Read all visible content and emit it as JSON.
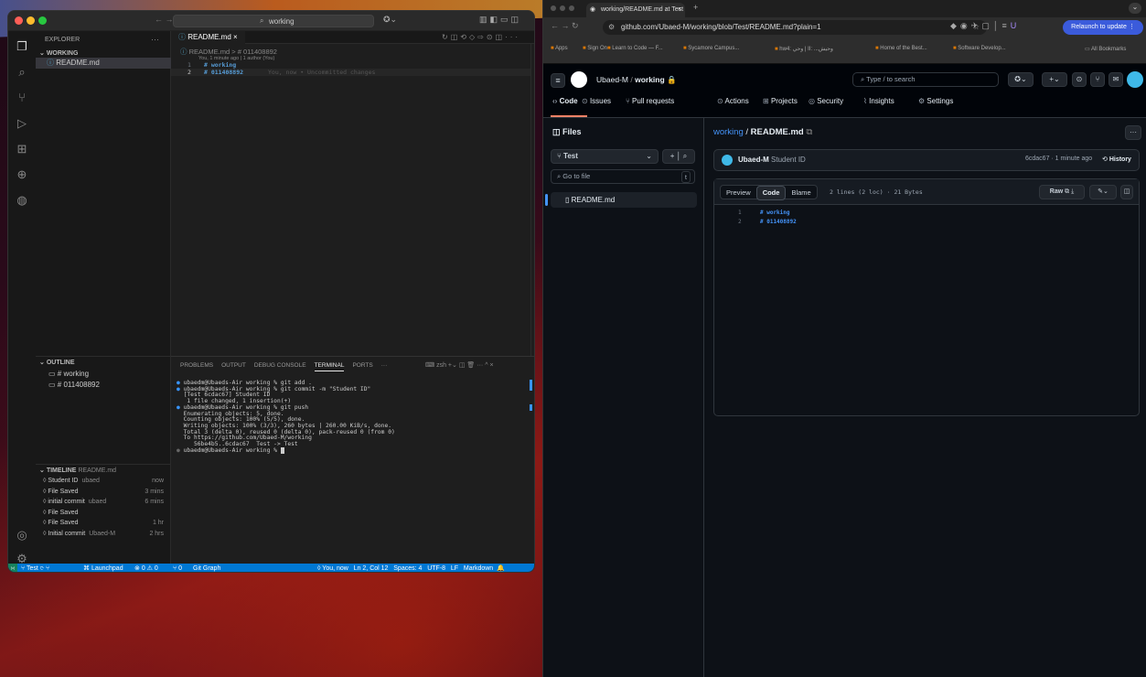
{
  "vscode": {
    "search": "working",
    "explorer_label": "EXPLORER",
    "folder": "WORKING",
    "file": "README.md",
    "tab": "README.md",
    "breadcrumb": "README.md > # 011408892",
    "blame": "You, 1 minute ago | 1 author (You)",
    "lines": [
      {
        "n": "1",
        "text": "# working",
        "note": ""
      },
      {
        "n": "2",
        "text": "# 011408892",
        "note": "You, now • Uncommitted changes"
      }
    ],
    "outline_label": "OUTLINE",
    "outline": [
      "# working",
      "# 011408892"
    ],
    "timeline_label": "TIMELINE",
    "timeline_file": "README.md",
    "timeline": [
      {
        "label": "Student ID",
        "who": "ubaed",
        "time": "now"
      },
      {
        "label": "File Saved",
        "who": "",
        "time": "3 mins"
      },
      {
        "label": "initial commit",
        "who": "ubaed",
        "time": "6 mins"
      },
      {
        "label": "File Saved",
        "who": "",
        "time": ""
      },
      {
        "label": "File Saved",
        "who": "",
        "time": "1 hr"
      },
      {
        "label": "Initial commit",
        "who": "Ubaed-M",
        "time": "2 hrs"
      }
    ],
    "panel_tabs": [
      "PROBLEMS",
      "OUTPUT",
      "DEBUG CONSOLE",
      "TERMINAL",
      "PORTS"
    ],
    "shell": "zsh",
    "terminal": [
      "ubaedm@Ubaeds-Air working % git add .",
      "ubaedm@Ubaeds-Air working % git commit -m \"Student ID\"",
      "[Test 6cdac67] Student ID",
      " 1 file changed, 1 insertion(+)",
      "ubaedm@Ubaeds-Air working % git push",
      "Enumerating objects: 5, done.",
      "Counting objects: 100% (5/5), done.",
      "Writing objects: 100% (3/3), 260 bytes | 260.00 KiB/s, done.",
      "Total 3 (delta 0), reused 0 (delta 0), pack-reused 0 (from 0)",
      "To https://github.com/Ubaed-M/working",
      "   56be4b5..6cdac67  Test -> Test",
      "ubaedm@Ubaeds-Air working % "
    ],
    "status_left": [
      "Test",
      "Launchpad",
      "0",
      "0",
      "0",
      "Git Graph"
    ],
    "status_right": "You, now   Ln 2, Col 12   Spaces: 4   UTF-8   LF   Markdown"
  },
  "chrome": {
    "tab_title": "working/README.md at Test",
    "url": "github.com/Ubaed-M/working/blob/Test/README.md?plain=1",
    "relaunch": "Relaunch to update",
    "bookmarks": [
      "Apps",
      "Sign On",
      "Learn to Code — F...",
      "Sycamore Campus...",
      "hw4: وحي | II: ...وحيش",
      "Home of the Best...",
      "Software Develop..."
    ],
    "all_bookmarks": "All Bookmarks"
  },
  "github": {
    "owner": "Ubaed-M",
    "repo": "working",
    "search": "Type / to search",
    "nav": [
      "Code",
      "Issues",
      "Pull requests",
      "Actions",
      "Projects",
      "Security",
      "Insights",
      "Settings"
    ],
    "files_label": "Files",
    "branch": "Test",
    "goto": "Go to file",
    "goto_key": "t",
    "file": "README.md",
    "path_repo": "working",
    "path_file": "README.md",
    "commit_author": "Ubaed-M",
    "commit_msg": "Student ID",
    "commit_meta": "6cdac67 · 1 minute ago",
    "history": "History",
    "views": [
      "Preview",
      "Code",
      "Blame"
    ],
    "file_info": "2 lines (2 loc) · 21 Bytes",
    "raw": "Raw",
    "lines": [
      {
        "n": "1",
        "text": "# working"
      },
      {
        "n": "2",
        "text": "# 011408892"
      }
    ]
  },
  "colors": {
    "vscode_accent": "#0078d4",
    "gh_link": "#4493f8",
    "heading_blue": "#569cd6"
  }
}
